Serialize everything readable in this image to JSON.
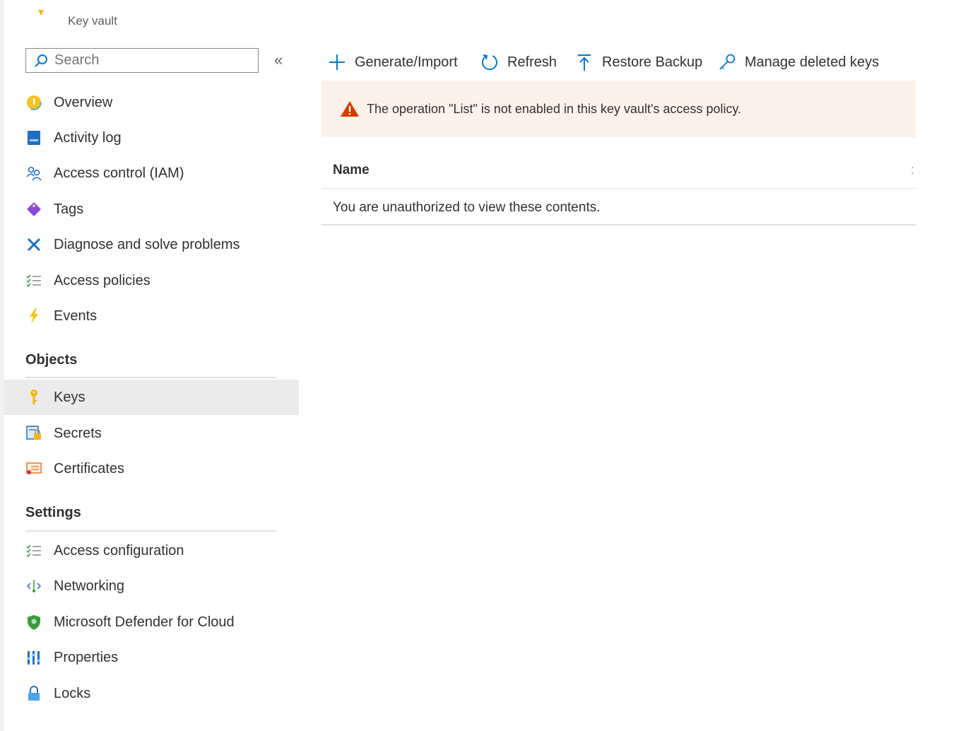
{
  "header": {
    "resource_type": "Key vault"
  },
  "sidebar": {
    "search_placeholder": "Search",
    "collapse_glyph": "«",
    "items": [
      {
        "label": "Overview",
        "icon": "overview-icon"
      },
      {
        "label": "Activity log",
        "icon": "activity-log-icon"
      },
      {
        "label": "Access control (IAM)",
        "icon": "people-icon"
      },
      {
        "label": "Tags",
        "icon": "tag-icon"
      },
      {
        "label": "Diagnose and solve problems",
        "icon": "wrench-icon"
      },
      {
        "label": "Access policies",
        "icon": "checklist-icon"
      },
      {
        "label": "Events",
        "icon": "lightning-icon"
      }
    ],
    "sections": [
      {
        "title": "Objects",
        "items": [
          {
            "label": "Keys",
            "icon": "key-icon",
            "active": true
          },
          {
            "label": "Secrets",
            "icon": "secret-icon"
          },
          {
            "label": "Certificates",
            "icon": "certificate-icon"
          }
        ]
      },
      {
        "title": "Settings",
        "items": [
          {
            "label": "Access configuration",
            "icon": "checklist-icon"
          },
          {
            "label": "Networking",
            "icon": "network-icon"
          },
          {
            "label": "Microsoft Defender for Cloud",
            "icon": "shield-icon"
          },
          {
            "label": "Properties",
            "icon": "properties-icon"
          },
          {
            "label": "Locks",
            "icon": "lock-icon"
          }
        ]
      }
    ]
  },
  "toolbar": {
    "generate_label": "Generate/Import",
    "refresh_label": "Refresh",
    "restore_label": "Restore Backup",
    "manage_deleted_label": "Manage deleted keys"
  },
  "warning": {
    "text": "The operation \"List\" is not enabled in this key vault's access policy."
  },
  "table": {
    "columns": [
      "Name"
    ],
    "column_menu_glyph": ":",
    "empty_message": "You are unauthorized to view these contents."
  },
  "colors": {
    "accent": "#0078d4",
    "warning_bg": "#fdf2ea",
    "warning_icon": "#d83b01",
    "active_bg": "#ebebeb"
  }
}
